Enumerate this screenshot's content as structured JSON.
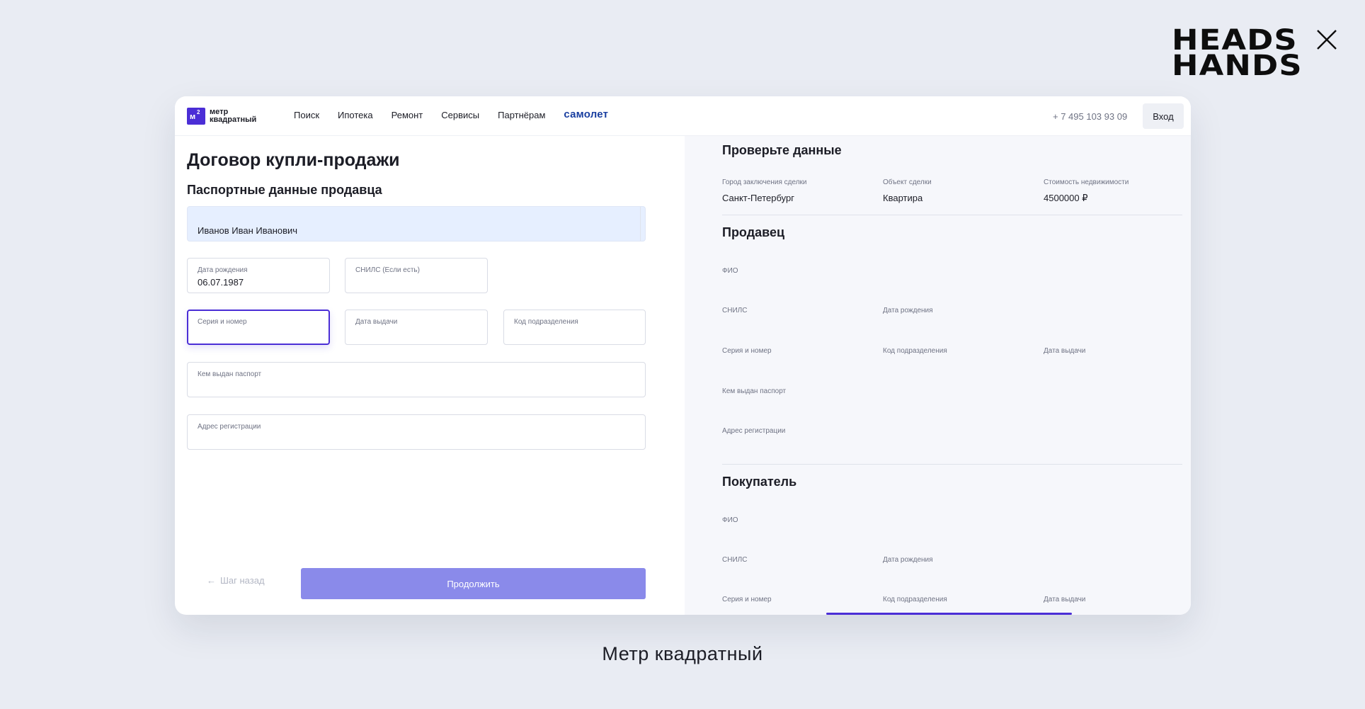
{
  "brand_logo": {
    "line1": "HEADS",
    "line2": "HANDS"
  },
  "site": {
    "logo_text_line1": "метр",
    "logo_text_line2": "квадратный",
    "logo_mark": "м",
    "logo_mark_sup": "2",
    "nav": [
      "Поиск",
      "Ипотека",
      "Ремонт",
      "Сервисы",
      "Партнёрам"
    ],
    "partner": "самолет",
    "phone": "+ 7 495 103 93 09",
    "login": "Вход"
  },
  "form": {
    "title": "Договор купли-продажи",
    "section": "Паспортные данные продавца",
    "full_name": "Иванов Иван Иванович",
    "birth_date_label": "Дата рождения",
    "birth_date_value": "06.07.1987",
    "snils_label": "СНИЛС (Если есть)",
    "series_label": "Серия и номер",
    "issue_date_label": "Дата выдачи",
    "dept_code_label": "Код подразделения",
    "issued_by_label": "Кем выдан паспорт",
    "address_label": "Адрес регистрации",
    "back": "Шаг назад",
    "continue": "Продолжить"
  },
  "summary": {
    "title": "Проверьте данные",
    "city_label": "Город заключения сделки",
    "city_value": "Санкт-Петербург",
    "object_label": "Объект сделки",
    "object_value": "Квартира",
    "price_label": "Стоимость недвижимости",
    "price_value": "4500000 ₽",
    "seller": {
      "title": "Продавец",
      "fio": "ФИО",
      "snils": "СНИЛС",
      "birth": "Дата рождения",
      "series": "Серия и номер",
      "dept": "Код подразделения",
      "issue": "Дата выдачи",
      "issued_by": "Кем выдан паспорт",
      "address": "Адрес регистрации"
    },
    "buyer": {
      "title": "Покупатель",
      "fio": "ФИО",
      "snils": "СНИЛС",
      "birth": "Дата рождения",
      "series": "Серия и номер",
      "dept": "Код подразделения",
      "issue": "Дата выдачи"
    }
  },
  "caption": "Метр квадратный",
  "colors": {
    "accent": "#4b2ed6",
    "button": "#8a8aea",
    "partner": "#1a3fa0",
    "highlight": "#e6efff"
  }
}
